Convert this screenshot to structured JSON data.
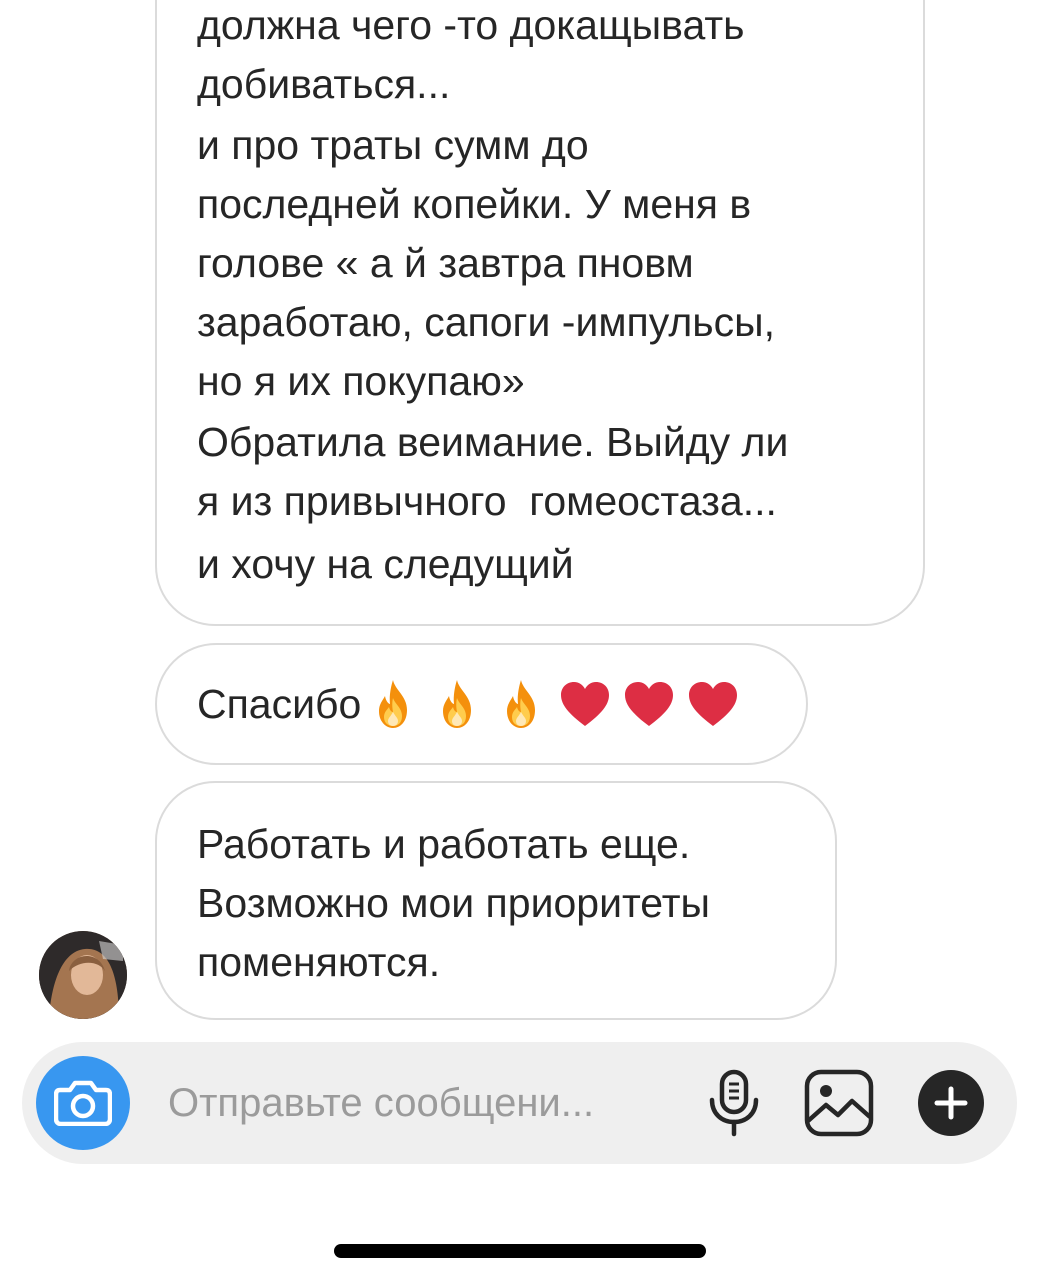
{
  "messages": [
    {
      "paragraphs": [
        "должна чего -то докащывать\nдобиваться...",
        "и про траты сумм до\nпоследней копейки. У меня в\nголове « а й завтра пновм\nзаработаю, сапоги -импульсы,\nно я их покупаю»",
        "Обратила веимание. Выйду ли\nя из привычного  гомеостаза...",
        "и хочу на следущий"
      ]
    },
    {
      "text": "Спасибо",
      "emojis": [
        "fire",
        "fire",
        "fire",
        "red-heart",
        "red-heart",
        "red-heart"
      ]
    },
    {
      "text": "Работать и работать еще.\nВозможно мои приоритеты\nпоменяются."
    }
  ],
  "composer": {
    "placeholder": "Отправьте сообщени...",
    "camera_color": "#3897f0",
    "icons": [
      "camera-icon",
      "microphone-icon",
      "gallery-icon",
      "plus-icon"
    ]
  },
  "colors": {
    "bubble_border": "#dbdbdb",
    "composer_bg": "#efefef",
    "text": "#262626",
    "placeholder": "#9b9b9b"
  }
}
